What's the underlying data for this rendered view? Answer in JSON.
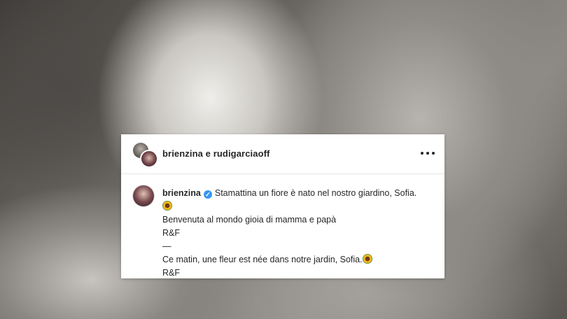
{
  "post": {
    "header_title": "brienzina e rudigarciaoff",
    "caption": {
      "username": "brienzina",
      "verified_icon": "✓",
      "lines": [
        "Stamattina un fiore è nato nel nostro giardino, Sofia.",
        "Benvenuta al mondo gioia di mamma e papà",
        "R&F",
        "—",
        "Ce matin, une fleur est née dans notre jardin, Sofia.",
        "R&F"
      ]
    },
    "icons": {
      "more": "more-options-icon",
      "verified": "verified-badge-icon",
      "flower": "sunflower-emoji-icon"
    },
    "colors": {
      "text": "#262626",
      "verified": "#3897f0"
    }
  }
}
